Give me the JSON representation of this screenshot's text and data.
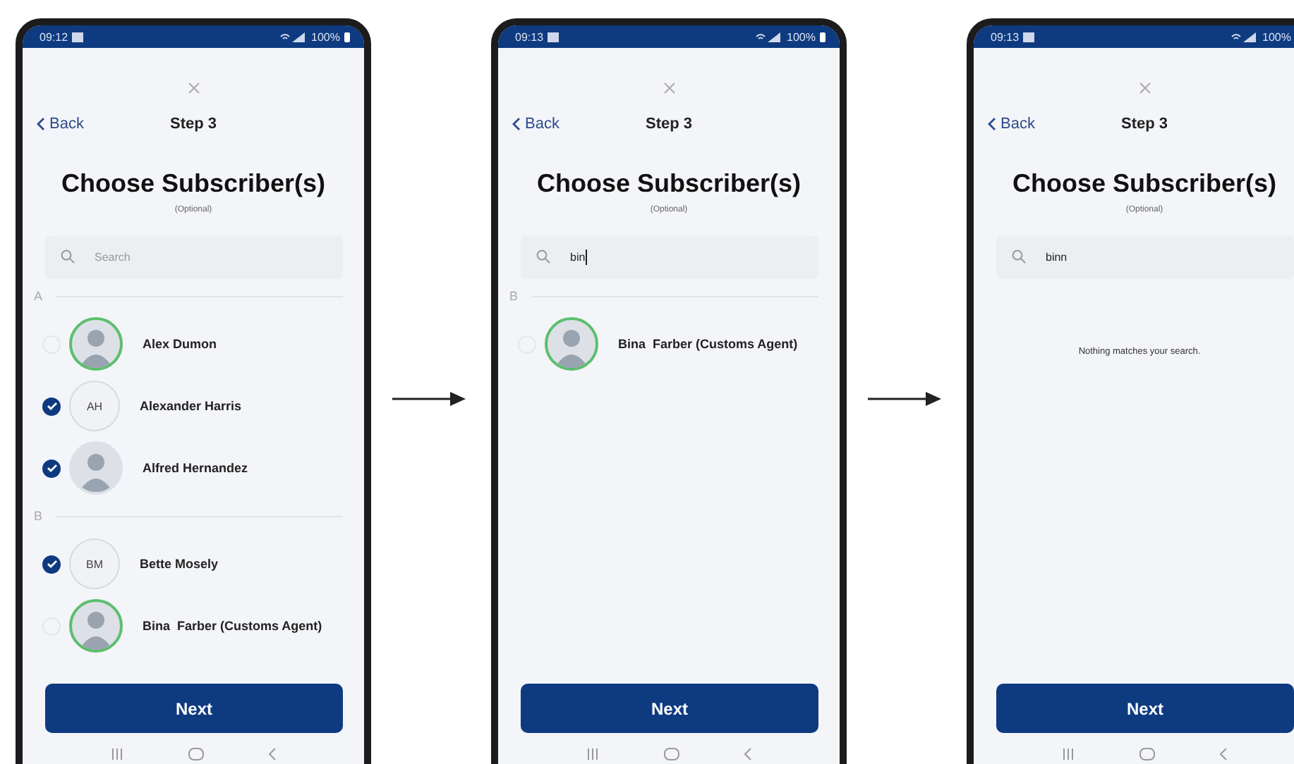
{
  "screens": [
    {
      "status_bar": {
        "time": "09:12",
        "battery": "100%"
      },
      "back": "Back",
      "step": "Step 3",
      "title": "Choose Subscriber(s)",
      "subtitle": "(Optional)",
      "search": {
        "placeholder": "Search",
        "focused": false
      },
      "sections": [
        {
          "letter": "A",
          "contacts": [
            {
              "name": "Alex Dumon",
              "kind": "photo",
              "ringed": true,
              "checked": false
            },
            {
              "name": "Alexander Harris",
              "kind": "initials",
              "initials": "AH",
              "checked": true
            },
            {
              "name": "Alfred Hernandez",
              "kind": "photo",
              "ringed": false,
              "checked": true
            }
          ]
        },
        {
          "letter": "B",
          "contacts": [
            {
              "name": "Bette Mosely",
              "kind": "initials",
              "initials": "BM",
              "checked": true
            },
            {
              "name": "Bina  Farber (Customs Agent)",
              "kind": "photo",
              "ringed": true,
              "checked": false
            }
          ]
        }
      ],
      "next": "Next"
    },
    {
      "status_bar": {
        "time": "09:13",
        "battery": "100%"
      },
      "back": "Back",
      "step": "Step 3",
      "title": "Choose Subscriber(s)",
      "subtitle": "(Optional)",
      "search": {
        "value": "bin",
        "focused": true
      },
      "sections": [
        {
          "letter": "B",
          "contacts": [
            {
              "name": "Bina  Farber (Customs Agent)",
              "kind": "photo",
              "ringed": true,
              "checked": false
            }
          ]
        }
      ],
      "next": "Next"
    },
    {
      "status_bar": {
        "time": "09:13",
        "battery": "100%"
      },
      "back": "Back",
      "step": "Step 3",
      "title": "Choose Subscriber(s)",
      "subtitle": "(Optional)",
      "search": {
        "value": "binn",
        "focused": false
      },
      "empty_message": "Nothing matches your search.",
      "next": "Next"
    }
  ]
}
